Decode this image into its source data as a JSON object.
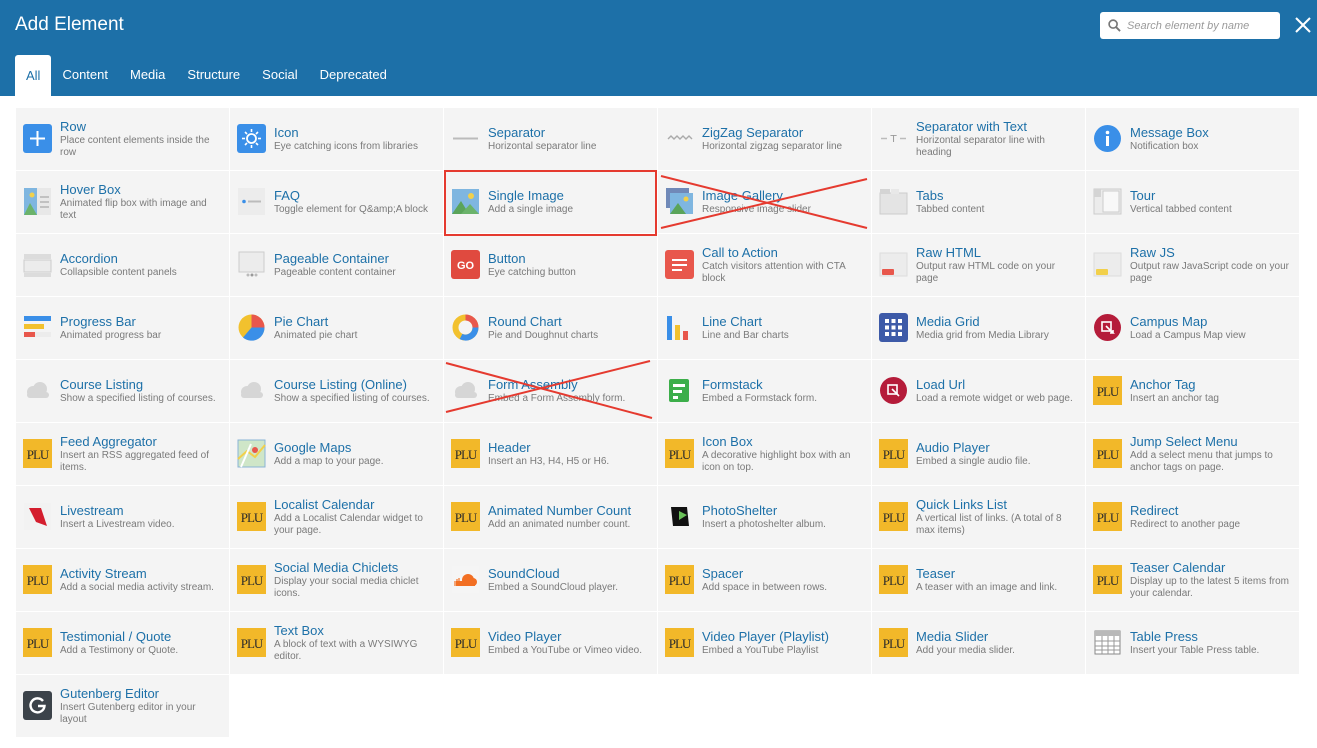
{
  "header": {
    "title": "Add Element",
    "search_placeholder": "Search element by name",
    "search_icon": "search-icon",
    "close_icon": "close-icon"
  },
  "tabs": [
    {
      "label": "All",
      "active": true
    },
    {
      "label": "Content"
    },
    {
      "label": "Media"
    },
    {
      "label": "Structure"
    },
    {
      "label": "Social"
    },
    {
      "label": "Deprecated"
    }
  ],
  "elements": [
    {
      "name": "Row",
      "desc": "Place content elements inside the row",
      "icon": "plus"
    },
    {
      "name": "Icon",
      "desc": "Eye catching icons from libraries",
      "icon": "sun"
    },
    {
      "name": "Separator",
      "desc": "Horizontal separator line",
      "icon": "separator"
    },
    {
      "name": "ZigZag Separator",
      "desc": "Horizontal zigzag separator line",
      "icon": "zigzag"
    },
    {
      "name": "Separator with Text",
      "desc": "Horizontal separator line with heading",
      "icon": "septext"
    },
    {
      "name": "Message Box",
      "desc": "Notification box",
      "icon": "info"
    },
    {
      "name": "Hover Box",
      "desc": "Animated flip box with image and text",
      "icon": "hoverbox"
    },
    {
      "name": "FAQ",
      "desc": "Toggle element for Q&amp;A block",
      "icon": "faq"
    },
    {
      "name": "Single Image",
      "desc": "Add a single image",
      "icon": "image"
    },
    {
      "name": "Image Gallery",
      "desc": "Responsive image slider",
      "icon": "gallery"
    },
    {
      "name": "Tabs",
      "desc": "Tabbed content",
      "icon": "tabs"
    },
    {
      "name": "Tour",
      "desc": "Vertical tabbed content",
      "icon": "tour"
    },
    {
      "name": "Accordion",
      "desc": "Collapsible content panels",
      "icon": "accordion"
    },
    {
      "name": "Pageable Container",
      "desc": "Pageable content container",
      "icon": "pageable"
    },
    {
      "name": "Button",
      "desc": "Eye catching button",
      "icon": "go"
    },
    {
      "name": "Call to Action",
      "desc": "Catch visitors attention with CTA block",
      "icon": "cta"
    },
    {
      "name": "Raw HTML",
      "desc": "Output raw HTML code on your page",
      "icon": "rawhtml"
    },
    {
      "name": "Raw JS",
      "desc": "Output raw JavaScript code on your page",
      "icon": "rawjs"
    },
    {
      "name": "Progress Bar",
      "desc": "Animated progress bar",
      "icon": "progress"
    },
    {
      "name": "Pie Chart",
      "desc": "Animated pie chart",
      "icon": "pie"
    },
    {
      "name": "Round Chart",
      "desc": "Pie and Doughnut charts",
      "icon": "donut"
    },
    {
      "name": "Line Chart",
      "desc": "Line and Bar charts",
      "icon": "linechart"
    },
    {
      "name": "Media Grid",
      "desc": "Media grid from Media Library",
      "icon": "mediagrid"
    },
    {
      "name": "Campus Map",
      "desc": "Load a Campus Map view",
      "icon": "campusmap"
    },
    {
      "name": "Course Listing",
      "desc": "Show a specified listing of courses.",
      "icon": "cloud"
    },
    {
      "name": "Course Listing (Online)",
      "desc": "Show a specified listing of courses.",
      "icon": "cloud"
    },
    {
      "name": "Form Assembly",
      "desc": "Embed a Form Assembly form.",
      "icon": "cloud"
    },
    {
      "name": "Formstack",
      "desc": "Embed a Formstack form.",
      "icon": "formstack"
    },
    {
      "name": "Load Url",
      "desc": "Load a remote widget or web page.",
      "icon": "loadurl"
    },
    {
      "name": "Anchor Tag",
      "desc": "Insert an anchor tag",
      "icon": "plu"
    },
    {
      "name": "Feed Aggregator",
      "desc": "Insert an RSS aggregated feed of items.",
      "icon": "plu"
    },
    {
      "name": "Google Maps",
      "desc": "Add a map to your page.",
      "icon": "map"
    },
    {
      "name": "Header",
      "desc": "Insert an H3, H4, H5 or H6.",
      "icon": "plu"
    },
    {
      "name": "Icon Box",
      "desc": "A decorative highlight box with an icon on top.",
      "icon": "plu"
    },
    {
      "name": "Audio Player",
      "desc": "Embed a single audio file.",
      "icon": "plu"
    },
    {
      "name": "Jump Select Menu",
      "desc": "Add a select menu that jumps to anchor tags on page.",
      "icon": "plu"
    },
    {
      "name": "Livestream",
      "desc": "Insert a Livestream video.",
      "icon": "livestream"
    },
    {
      "name": "Localist Calendar",
      "desc": "Add a Localist Calendar widget to your page.",
      "icon": "plu"
    },
    {
      "name": "Animated Number Count",
      "desc": "Add an animated number count.",
      "icon": "plu"
    },
    {
      "name": "PhotoShelter",
      "desc": "Insert a photoshelter album.",
      "icon": "photoshelter"
    },
    {
      "name": "Quick Links List",
      "desc": "A vertical list of links. (A total of 8 max items)",
      "icon": "plu"
    },
    {
      "name": "Redirect",
      "desc": "Redirect to another page",
      "icon": "plu"
    },
    {
      "name": "Activity Stream",
      "desc": "Add a social media activity stream.",
      "icon": "plu"
    },
    {
      "name": "Social Media Chiclets",
      "desc": "Display your social media chiclet icons.",
      "icon": "plu"
    },
    {
      "name": "SoundCloud",
      "desc": "Embed a SoundCloud player.",
      "icon": "soundcloud"
    },
    {
      "name": "Spacer",
      "desc": "Add space in between rows.",
      "icon": "plu"
    },
    {
      "name": "Teaser",
      "desc": "A teaser with an image and link.",
      "icon": "plu"
    },
    {
      "name": "Teaser Calendar",
      "desc": "Display up to the latest 5 items from your calendar.",
      "icon": "plu"
    },
    {
      "name": "Testimonial / Quote",
      "desc": "Add a Testimony or Quote.",
      "icon": "plu"
    },
    {
      "name": "Text Box",
      "desc": "A block of text with a WYSIWYG editor.",
      "icon": "plu"
    },
    {
      "name": "Video Player",
      "desc": "Embed a YouTube or Vimeo video.",
      "icon": "plu"
    },
    {
      "name": "Video Player (Playlist)",
      "desc": "Embed a YouTube Playlist",
      "icon": "plu"
    },
    {
      "name": "Media Slider",
      "desc": "Add your media slider.",
      "icon": "plu"
    },
    {
      "name": "Table Press",
      "desc": "Insert your Table Press table.",
      "icon": "table"
    },
    {
      "name": "Gutenberg Editor",
      "desc": "Insert Gutenberg editor in your layout",
      "icon": "gutenberg"
    }
  ],
  "plu_logo_text": "PLU",
  "go_text": "GO",
  "colors": {
    "header": "#1d70a8",
    "annotation_red": "#e53a2f",
    "plu_gold": "#f2b829"
  }
}
